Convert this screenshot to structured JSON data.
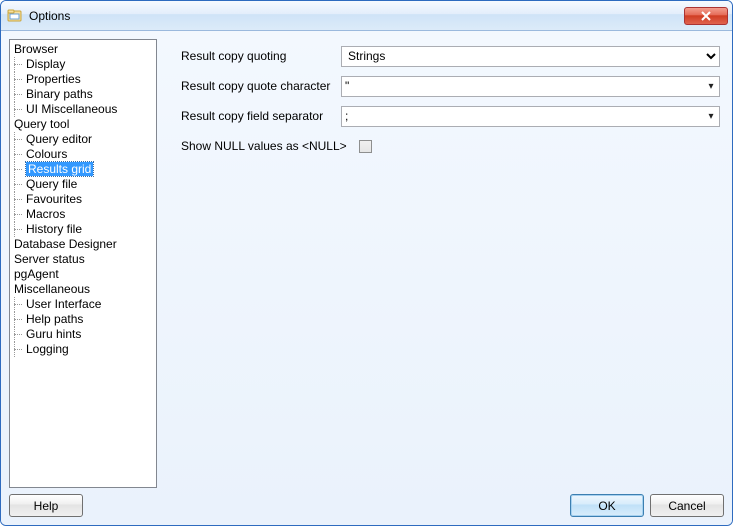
{
  "window": {
    "title": "Options"
  },
  "tree": {
    "groups": [
      {
        "label": "Browser",
        "items": [
          "Display",
          "Properties",
          "Binary paths",
          "UI Miscellaneous"
        ]
      },
      {
        "label": "Query tool",
        "items": [
          "Query editor",
          "Colours",
          "Results grid",
          "Query file",
          "Favourites",
          "Macros",
          "History file"
        ]
      },
      {
        "label": "Database Designer",
        "items": []
      },
      {
        "label": "Server status",
        "items": []
      },
      {
        "label": "pgAgent",
        "items": []
      },
      {
        "label": "Miscellaneous",
        "items": [
          "User Interface",
          "Help paths",
          "Guru hints",
          "Logging"
        ]
      }
    ],
    "selected": "Results grid"
  },
  "form": {
    "quoting": {
      "label": "Result copy quoting",
      "value": "Strings"
    },
    "quote_char": {
      "label": "Result copy quote character",
      "value": "\""
    },
    "field_sep": {
      "label": "Result copy field separator",
      "value": ";"
    },
    "show_null": {
      "label": "Show NULL values as <NULL>",
      "checked": false
    }
  },
  "buttons": {
    "help": "Help",
    "ok": "OK",
    "cancel": "Cancel"
  }
}
